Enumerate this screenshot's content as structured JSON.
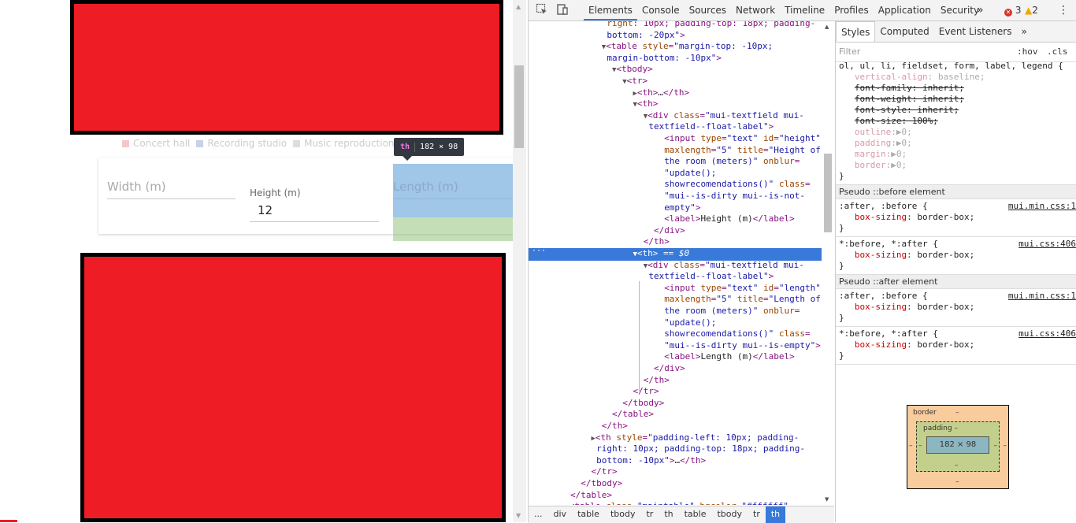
{
  "page": {
    "legend": [
      {
        "label": "Concert hall",
        "color": "#f4c7c9"
      },
      {
        "label": "Recording studio",
        "color": "#c9d0e9"
      },
      {
        "label": "Music reproduction ro",
        "color": "#dddddd"
      }
    ],
    "width_placeholder": "Width (m)",
    "height_label": "Height (m)",
    "height_value": "12",
    "length_placeholder": "Length (m)"
  },
  "tooltip": {
    "tag": "th",
    "size": "182 × 98"
  },
  "devtools": {
    "tabs": [
      "Elements",
      "Console",
      "Sources",
      "Network",
      "Timeline",
      "Profiles",
      "Application",
      "Security"
    ],
    "more": "»",
    "errors": "3",
    "warnings": "2",
    "selected_marker": "== $0",
    "dots": "···",
    "breadcrumbs": [
      "...",
      "div",
      "table",
      "tbody",
      "tr",
      "th",
      "table",
      "tbody",
      "tr",
      "th"
    ],
    "styles_tabs": [
      "Styles",
      "Computed",
      "Event Listeners"
    ],
    "filter_placeholder": "Filter",
    "hov": ":hov",
    "cls": ".cls",
    "pseudo_before": "Pseudo ::before element",
    "pseudo_after": "Pseudo ::after element",
    "src_min": "mui.min.css:1",
    "src_css": "mui.css:406",
    "box_border": "border",
    "box_padding": "padding",
    "box_dash": "–",
    "box_content": "182 × 98"
  }
}
